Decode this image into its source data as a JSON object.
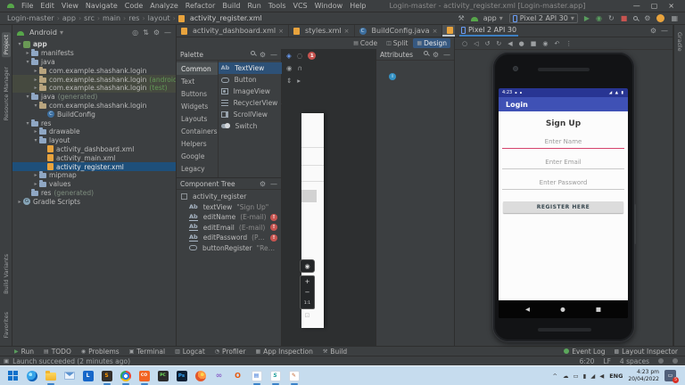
{
  "titlebar": {
    "menu": [
      "File",
      "Edit",
      "View",
      "Navigate",
      "Code",
      "Analyze",
      "Refactor",
      "Build",
      "Run",
      "Tools",
      "VCS",
      "Window",
      "Help"
    ],
    "title": "Login-master - activity_register.xml [Login-master.app]"
  },
  "toolbar": {
    "breadcrumbs": [
      "Login-master",
      "app",
      "src",
      "main",
      "res",
      "layout"
    ],
    "file": "activity_register.xml",
    "run_config": "app",
    "device": "Pixel 2 API 30",
    "actions": [
      "build-hammer",
      "run",
      "debug",
      "sync",
      "stop",
      "search-everywhere",
      "settings",
      "profile-avatar"
    ]
  },
  "tool_strips": {
    "left_top": [
      "Project",
      "Resource Manager"
    ],
    "left_bottom": [
      "Build Variants",
      "Favorites"
    ],
    "right_top": [
      "Gradle"
    ]
  },
  "project": {
    "view": "Android",
    "head_icons": [
      "locate-icon",
      "expand-collapse-icon",
      "settings-gear-icon",
      "hide-icon"
    ],
    "tree": [
      {
        "label": "app",
        "level": 0,
        "arrow": "open",
        "icon": "app",
        "bold": true
      },
      {
        "label": "manifests",
        "level": 1,
        "arrow": "closed",
        "icon": "folder"
      },
      {
        "label": "java",
        "level": 1,
        "arrow": "open",
        "icon": "folder"
      },
      {
        "label": "com.example.shashank.login",
        "level": 2,
        "arrow": "closed",
        "icon": "package"
      },
      {
        "label": "com.example.shashank.login",
        "suffix": "(androidTest)",
        "level": 2,
        "arrow": "closed",
        "icon": "package",
        "tinted": true
      },
      {
        "label": "com.example.shashank.login",
        "suffix": "(test)",
        "level": 2,
        "arrow": "closed",
        "icon": "package",
        "tinted": true
      },
      {
        "label": "java",
        "suffix": "(generated)",
        "suffix_gray": true,
        "level": 1,
        "arrow": "open",
        "icon": "folder"
      },
      {
        "label": "com.example.shashank.login",
        "level": 2,
        "arrow": "open",
        "icon": "package"
      },
      {
        "label": "BuildConfig",
        "level": 3,
        "icon": "class"
      },
      {
        "label": "res",
        "level": 1,
        "arrow": "open",
        "icon": "folder"
      },
      {
        "label": "drawable",
        "level": 2,
        "arrow": "closed",
        "icon": "folder"
      },
      {
        "label": "layout",
        "level": 2,
        "arrow": "open",
        "icon": "folder"
      },
      {
        "label": "activity_dashboard.xml",
        "level": 3,
        "icon": "xml"
      },
      {
        "label": "activity_main.xml",
        "level": 3,
        "icon": "xml"
      },
      {
        "label": "activity_register.xml",
        "level": 3,
        "icon": "xml",
        "selected": true
      },
      {
        "label": "mipmap",
        "level": 2,
        "arrow": "closed",
        "icon": "folder"
      },
      {
        "label": "values",
        "level": 2,
        "arrow": "closed",
        "icon": "folder"
      },
      {
        "label": "res",
        "suffix": "(generated)",
        "suffix_gray": true,
        "level": 1,
        "icon": "folder"
      },
      {
        "label": "Gradle Scripts",
        "level": 0,
        "arrow": "closed",
        "icon": "gradle"
      }
    ]
  },
  "editor": {
    "tabs": [
      {
        "label": "activity_dashboard.xml",
        "icon": "xml"
      },
      {
        "label": "styles.xml",
        "icon": "xml"
      },
      {
        "label": "BuildConfig.java",
        "icon": "class"
      },
      {
        "label": "activity_register.xml",
        "icon": "xml",
        "active": true
      }
    ],
    "modes": [
      {
        "label": "Code"
      },
      {
        "label": "Split"
      },
      {
        "label": "Design",
        "active": true
      }
    ]
  },
  "palette": {
    "title": "Palette",
    "categories": [
      {
        "label": "Common",
        "active": true
      },
      {
        "label": "Text"
      },
      {
        "label": "Buttons"
      },
      {
        "label": "Widgets"
      },
      {
        "label": "Layouts"
      },
      {
        "label": "Containers"
      },
      {
        "label": "Helpers"
      },
      {
        "label": "Google"
      },
      {
        "label": "Legacy"
      }
    ],
    "items": [
      {
        "label": "TextView",
        "icon": "textview",
        "active": true
      },
      {
        "label": "Button",
        "icon": "button"
      },
      {
        "label": "ImageView",
        "icon": "image"
      },
      {
        "label": "RecyclerView",
        "icon": "recycler",
        "download": true
      },
      {
        "label": "ScrollView",
        "icon": "scroll"
      },
      {
        "label": "Switch",
        "icon": "switch"
      }
    ]
  },
  "component_tree": {
    "title": "Component Tree",
    "rows": [
      {
        "label": "activity_register",
        "icon": "layout",
        "level": 0
      },
      {
        "label": "textView",
        "quote": "\"Sign Up\"",
        "icon": "textview",
        "level": 1
      },
      {
        "label": "editName",
        "quote": "(E-mail)",
        "icon": "edittext",
        "level": 1,
        "error": true
      },
      {
        "label": "editEmail",
        "quote": "(E-mail)",
        "icon": "edittext",
        "level": 1,
        "error": true
      },
      {
        "label": "editPassword",
        "quote": "(Password)",
        "icon": "edittext",
        "level": 1,
        "error": true
      },
      {
        "label": "buttonRegister",
        "quote": "\"Reg Her\"",
        "icon": "button",
        "level": 1
      }
    ]
  },
  "design": {
    "error_count": "1",
    "zoom_plus": "+",
    "zoom_minus": "−",
    "zoom_label": "1:1"
  },
  "attributes": {
    "title": "Attributes"
  },
  "emulator": {
    "tab": "Pixel 2 API 30",
    "controls": [
      "power",
      "volume",
      "rotate-left",
      "rotate-right",
      "back",
      "home",
      "overview",
      "screenshot",
      "snapshots",
      "more"
    ],
    "phone": {
      "status_time": "4:23",
      "app_bar": "Login",
      "heading": "Sign Up",
      "fields": [
        {
          "hint": "Enter Name",
          "focused": true
        },
        {
          "hint": "Enter Email"
        },
        {
          "hint": "Enter Password"
        }
      ],
      "button": "REGISTER HERE"
    }
  },
  "bottom_bar": {
    "left": [
      {
        "label": "Run",
        "icon": "run"
      },
      {
        "label": "TODO",
        "icon": "todo"
      },
      {
        "label": "Problems",
        "icon": "problems"
      },
      {
        "label": "Terminal",
        "icon": "terminal"
      },
      {
        "label": "Logcat",
        "icon": "logcat"
      },
      {
        "label": "Profiler",
        "icon": "profiler"
      },
      {
        "label": "App Inspection",
        "icon": "inspection"
      },
      {
        "label": "Build",
        "icon": "build"
      }
    ],
    "right": [
      {
        "label": "Event Log",
        "icon": "event-log"
      },
      {
        "label": "Layout Inspector",
        "icon": "layout-inspector"
      }
    ]
  },
  "status_bar": {
    "message": "Launch succeeded (2 minutes ago)",
    "position": "6:20",
    "line_ending": "LF",
    "indent": "4 spaces"
  },
  "taskbar": {
    "apps": [
      {
        "name": "start"
      },
      {
        "name": "edge"
      },
      {
        "name": "explorer",
        "active": true
      },
      {
        "name": "mail"
      },
      {
        "name": "lapp"
      },
      {
        "name": "sublime",
        "active": true
      },
      {
        "name": "chrome",
        "active": true
      },
      {
        "name": "coapp",
        "active": true
      },
      {
        "name": "pycharm"
      },
      {
        "name": "photoshop"
      },
      {
        "name": "firefox"
      },
      {
        "name": "vstudio"
      },
      {
        "name": "office"
      },
      {
        "name": "word",
        "active": true
      },
      {
        "name": "teal",
        "active": true
      },
      {
        "name": "brush",
        "active": true
      }
    ],
    "tray_icons": [
      "chevron-up",
      "cloud",
      "display",
      "battery",
      "network",
      "volume"
    ],
    "tray_lang": "ENG",
    "time": "4:23 pm",
    "date": "20/04/2022",
    "notif_count": "5"
  }
}
